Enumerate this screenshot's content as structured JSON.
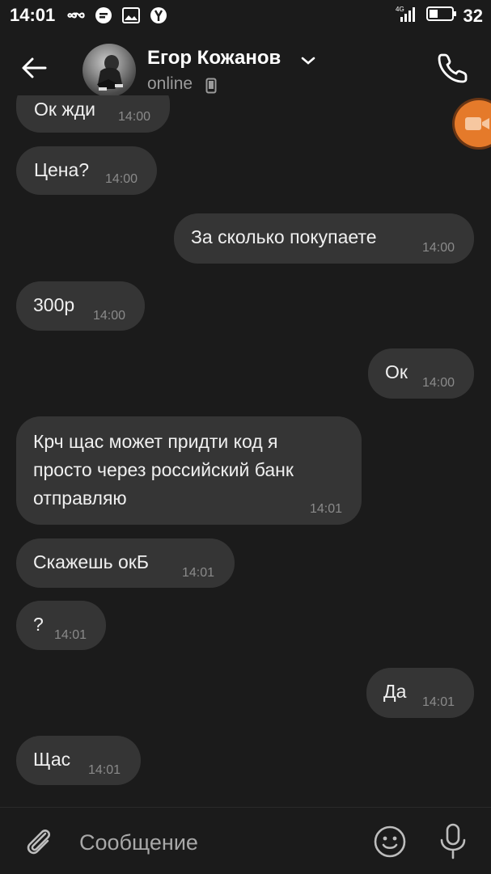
{
  "status_bar": {
    "time": "14:01",
    "network": "4G",
    "battery": "32",
    "icons": [
      "infinity-icon",
      "chat-bubble-icon",
      "image-icon",
      "yandex-icon",
      "signal-icon",
      "battery-icon"
    ]
  },
  "header": {
    "contact_name": "Егор Кожанов",
    "status": "online",
    "icons": [
      "back-arrow-icon",
      "chevron-down-icon",
      "mobile-device-icon",
      "phone-icon"
    ]
  },
  "messages": [
    {
      "id": "m1",
      "side": "in",
      "text": "Ок жди",
      "time": "14:00"
    },
    {
      "id": "m2",
      "side": "in",
      "text": "Цена?",
      "time": "14:00"
    },
    {
      "id": "m3",
      "side": "out",
      "text": "За сколько покупаете",
      "time": "14:00"
    },
    {
      "id": "m4",
      "side": "in",
      "text": "300р",
      "time": "14:00"
    },
    {
      "id": "m5",
      "side": "out",
      "text": "Ок",
      "time": "14:00"
    },
    {
      "id": "m6",
      "side": "in",
      "text": "Крч щас может придти код я\nпросто через российский банк\nотправляю",
      "time": "14:01"
    },
    {
      "id": "m7",
      "side": "in",
      "text": "Скажешь окБ",
      "time": "14:01"
    },
    {
      "id": "m8",
      "side": "in",
      "text": "?",
      "time": "14:01"
    },
    {
      "id": "m9",
      "side": "out",
      "text": "Да",
      "time": "14:01"
    },
    {
      "id": "m10",
      "side": "in",
      "text": "Щас",
      "time": "14:01"
    }
  ],
  "composer": {
    "placeholder": "Сообщение",
    "icons": [
      "paperclip-icon",
      "emoji-icon",
      "microphone-icon"
    ]
  },
  "colors": {
    "background": "#1b1b1b",
    "bubble": "#353535",
    "accent_orange": "#e57a2a"
  }
}
